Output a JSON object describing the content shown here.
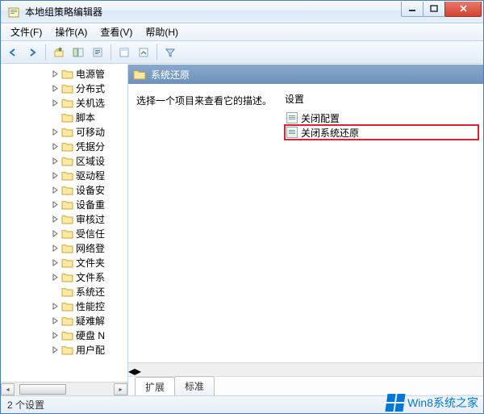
{
  "window": {
    "title": "本地组策略编辑器"
  },
  "menubar": {
    "file": "文件(F)",
    "action": "操作(A)",
    "view": "查看(V)",
    "help": "帮助(H)"
  },
  "tree": {
    "items": [
      {
        "label": "电源管"
      },
      {
        "label": "分布式"
      },
      {
        "label": "关机选"
      },
      {
        "label": "脚本"
      },
      {
        "label": "可移动"
      },
      {
        "label": "凭据分"
      },
      {
        "label": "区域设"
      },
      {
        "label": "驱动程"
      },
      {
        "label": "设备安"
      },
      {
        "label": "设备重"
      },
      {
        "label": "审核过"
      },
      {
        "label": "受信任"
      },
      {
        "label": "网络登"
      },
      {
        "label": "文件夹"
      },
      {
        "label": "文件系"
      },
      {
        "label": "系统还"
      },
      {
        "label": "性能控"
      },
      {
        "label": "疑难解"
      },
      {
        "label": "硬盘 N"
      },
      {
        "label": "用户配"
      }
    ]
  },
  "details": {
    "header": "系统还原",
    "description": "选择一个项目来查看它的描述。",
    "settings_header": "设置",
    "settings": [
      {
        "label": "关闭配置"
      },
      {
        "label": "关闭系统还原"
      }
    ]
  },
  "tabs": {
    "extended": "扩展",
    "standard": "标准"
  },
  "statusbar": {
    "text": "2 个设置"
  },
  "watermark": {
    "text": "Win8系统之家"
  }
}
